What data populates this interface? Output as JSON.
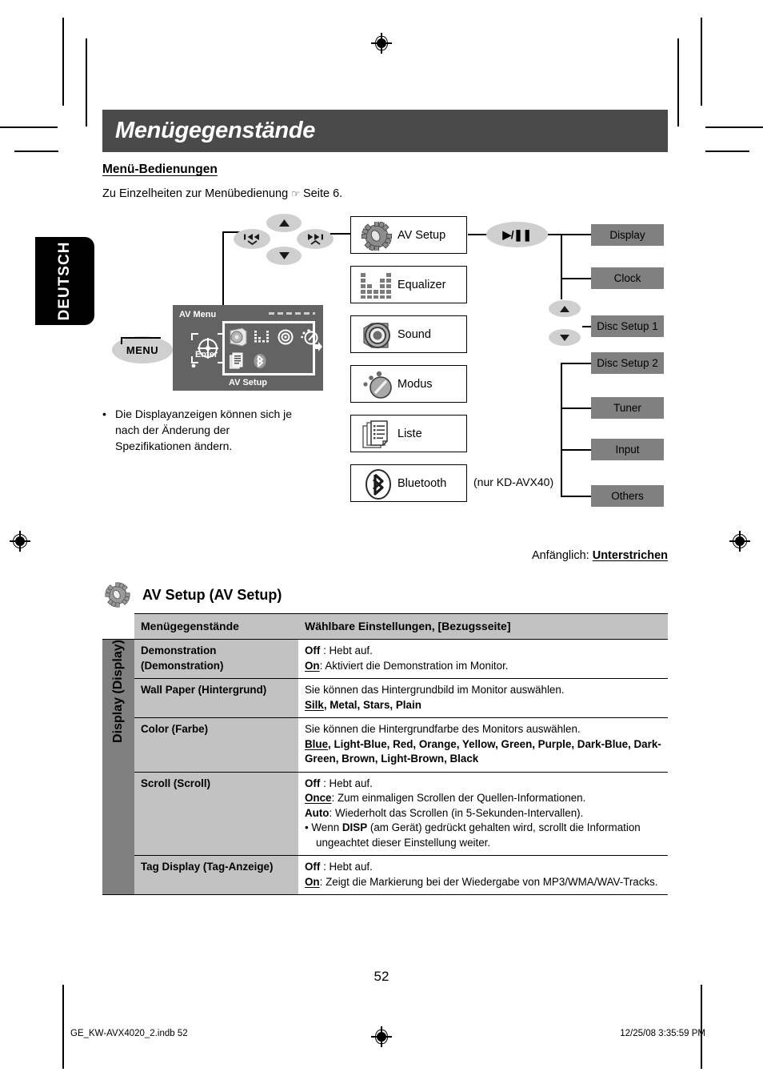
{
  "language_tab": "DEUTSCH",
  "header": {
    "title": "Menügegenstände",
    "subhead": "Menü-Bedienungen",
    "intro_before": "Zu Einzelheiten zur Menübedienung",
    "intro_after": "Seite 6."
  },
  "diagram": {
    "menu_button": "MENU",
    "mockup": {
      "top_label": "AV Menu",
      "enter_label": "Enter",
      "bottom_label": "AV Setup"
    },
    "menu_items": [
      {
        "label": "AV Setup",
        "icon": "gear-icon"
      },
      {
        "label": "Equalizer",
        "icon": "equalizer-icon"
      },
      {
        "label": "Sound",
        "icon": "speaker-icon"
      },
      {
        "label": "Modus",
        "icon": "mode-dial-icon"
      },
      {
        "label": "Liste",
        "icon": "list-pages-icon"
      },
      {
        "label": "Bluetooth",
        "icon": "bluetooth-icon"
      }
    ],
    "bluetooth_note": "(nur KD-AVX40)",
    "playpause_label": "▶/❚❚",
    "sub_items": [
      "Display",
      "Clock",
      "Disc Setup 1",
      "Disc Setup 2",
      "Tuner",
      "Input",
      "Others"
    ],
    "note_bullet": "•",
    "note_text": "Die Displayanzeigen können sich je nach der Änderung der Spezifikationen ändern."
  },
  "initial_note": {
    "prefix": "Anfänglich:",
    "value": "Unterstrichen"
  },
  "section": {
    "icon": "gear-icon",
    "heading": "AV Setup (AV Setup)"
  },
  "table": {
    "vertical_label": "Display (Display)",
    "headers": [
      "Menügegenstände",
      "Wählbare Einstellungen, [Bezugsseite]"
    ],
    "rows": [
      {
        "item_l1": "Demonstration",
        "item_l2": "(Demonstration)",
        "lines": [
          {
            "key": "Off",
            "key_underline": false,
            "sep": " : ",
            "text": "Hebt auf."
          },
          {
            "key": "On",
            "key_underline": true,
            "sep": ": ",
            "text": "Aktiviert die Demonstration im Monitor."
          }
        ]
      },
      {
        "item_l1": "Wall Paper (Hintergrund)",
        "item_l2": "",
        "lines": [
          {
            "key": "",
            "key_underline": false,
            "sep": "",
            "text": "Sie können das Hintergrundbild im Monitor auswählen."
          }
        ],
        "options": {
          "first": "Silk",
          "rest": ", Metal, Stars, Plain"
        }
      },
      {
        "item_l1": "Color (Farbe)",
        "item_l2": "",
        "lines": [
          {
            "key": "",
            "key_underline": false,
            "sep": "",
            "text": "Sie können die Hintergrundfarbe des Monitors auswählen."
          }
        ],
        "options": {
          "first": "Blue",
          "rest": ", Light-Blue, Red, Orange, Yellow, Green, Purple, Dark-Blue, Dark-Green, Brown, Light-Brown, Black"
        }
      },
      {
        "item_l1": "Scroll (Scroll)",
        "item_l2": "",
        "lines": [
          {
            "key": "Off",
            "key_underline": false,
            "sep": " : ",
            "text": "Hebt auf."
          },
          {
            "key": "Once",
            "key_underline": true,
            "sep": ": ",
            "text": "Zum einmaligen Scrollen der Quellen-Informationen."
          },
          {
            "key": "Auto",
            "key_underline": false,
            "sep": ": ",
            "text": "Wiederholt das Scrollen (in 5-Sekunden-Intervallen)."
          }
        ],
        "bullet_pre": "•  Wenn ",
        "bullet_bold": "DISP",
        "bullet_post": " (am Gerät) gedrückt gehalten wird, scrollt die Information ungeachtet dieser Einstellung weiter."
      },
      {
        "item_l1": "Tag Display (Tag-Anzeige)",
        "item_l2": "",
        "lines": [
          {
            "key": "Off",
            "key_underline": false,
            "sep": " : ",
            "text": "Hebt auf."
          },
          {
            "key": "On",
            "key_underline": true,
            "sep": ": ",
            "text": "Zeigt die Markierung bei der Wiedergabe von MP3/WMA/WAV-Tracks."
          }
        ]
      }
    ]
  },
  "page_number": "52",
  "footer": {
    "left": "GE_KW-AVX4020_2.indb   52",
    "right": "12/25/08   3:35:59 PM"
  }
}
